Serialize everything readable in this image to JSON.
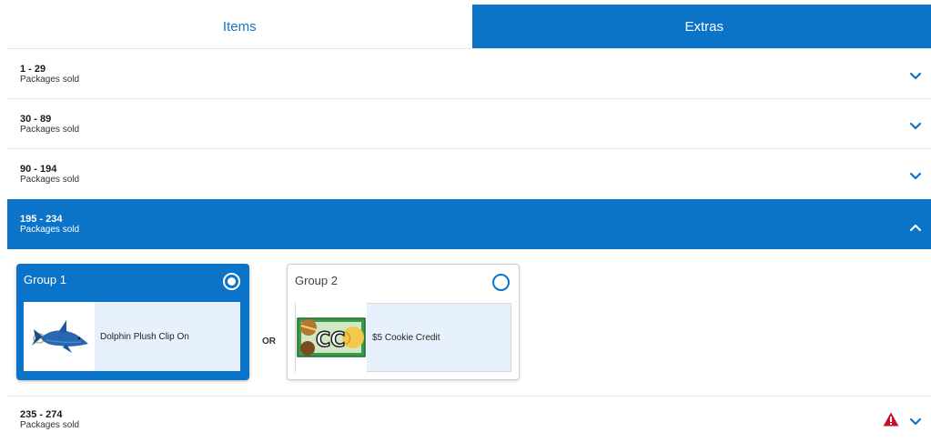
{
  "tabs": [
    {
      "label": "Items",
      "active": false
    },
    {
      "label": "Extras",
      "active": true
    }
  ],
  "rows": [
    {
      "range": "1 - 29",
      "subtitle": "Packages sold",
      "expanded": false,
      "warning": false
    },
    {
      "range": "30 - 89",
      "subtitle": "Packages sold",
      "expanded": false,
      "warning": false
    },
    {
      "range": "90 - 194",
      "subtitle": "Packages sold",
      "expanded": false,
      "warning": false
    },
    {
      "range": "195 - 234",
      "subtitle": "Packages sold",
      "expanded": true,
      "warning": false
    },
    {
      "range": "235 - 274",
      "subtitle": "Packages sold",
      "expanded": false,
      "warning": true
    }
  ],
  "groups": [
    {
      "label": "Group 1",
      "selected": true,
      "item": {
        "name": "Dolphin Plush Clip On",
        "icon": "dolphin-plush-image"
      }
    },
    {
      "label": "Group 2",
      "selected": false,
      "item": {
        "name": "$5 Cookie Credit",
        "icon": "cookie-credit-image"
      }
    }
  ],
  "or_label": "OR",
  "colors": {
    "accent": "#0b74c9",
    "warning": "#c8102e",
    "item_bg": "#e7f1fd"
  }
}
